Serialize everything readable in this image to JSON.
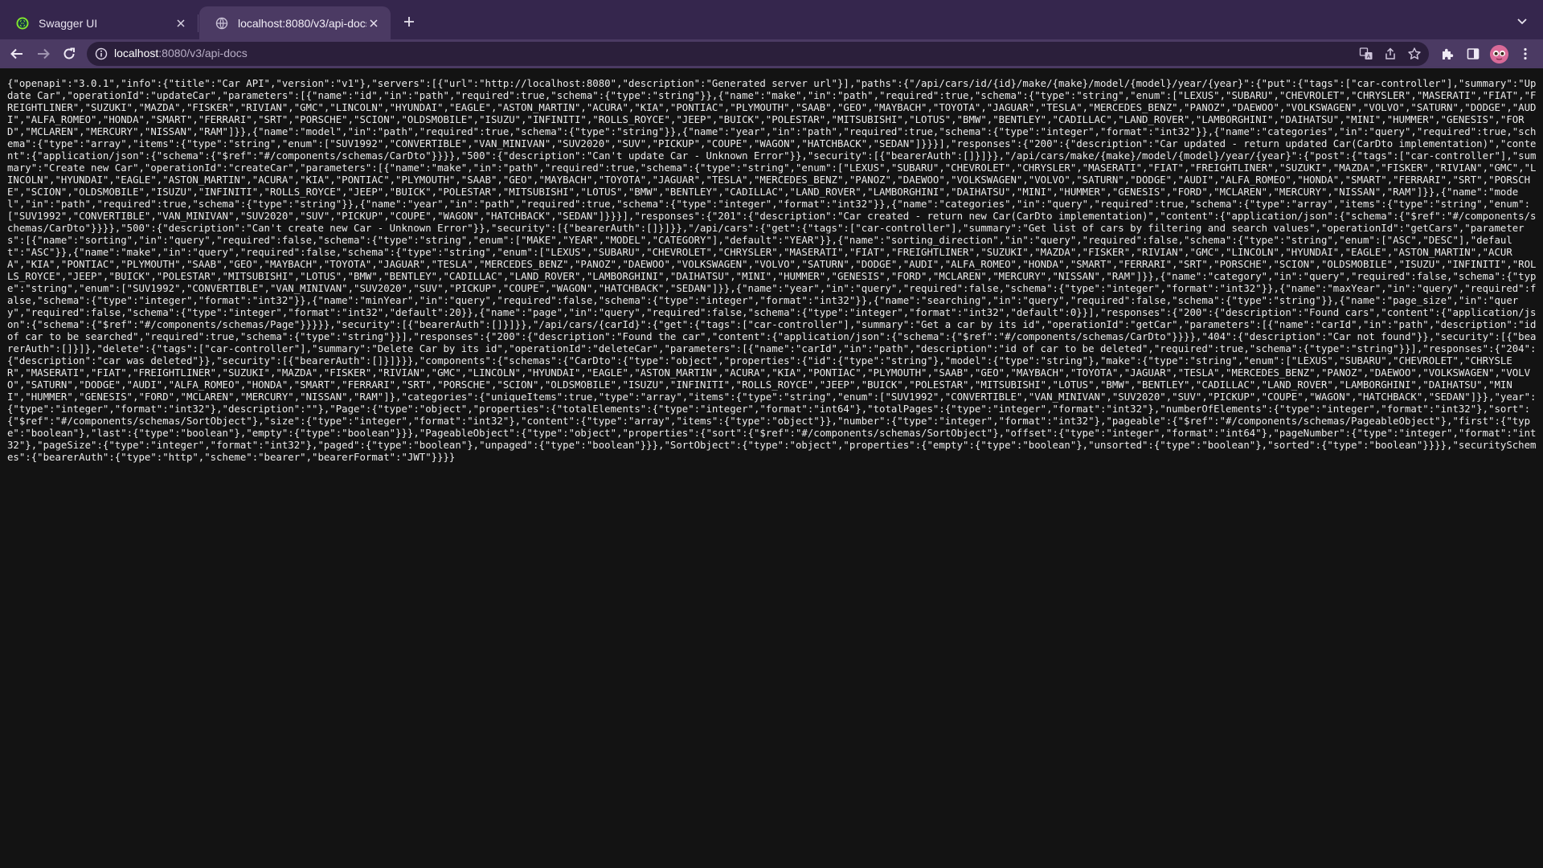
{
  "tabs": [
    {
      "title": "Swagger UI",
      "favicon": "swagger-globe-icon",
      "active": false
    },
    {
      "title": "localhost:8080/v3/api-docs",
      "favicon": "globe-icon",
      "active": true
    }
  ],
  "address_bar": {
    "host": "localhost",
    "path": ":8080/v3/api-docs"
  },
  "colors": {
    "tabstrip": "#35264d",
    "active_tab": "#4b3a63",
    "toolbar": "#4b3a63",
    "omnibox": "#2b1f3b",
    "page_background": "#131313",
    "text": "#ececec"
  },
  "content": {
    "json_text": "{\"openapi\":\"3.0.1\",\"info\":{\"title\":\"Car API\",\"version\":\"v1\"},\"servers\":[{\"url\":\"http://localhost:8080\",\"description\":\"Generated server url\"}],\"paths\":{\"/api/cars/id/{id}/make/{make}/model/{model}/year/{year}\":{\"put\":{\"tags\":[\"car-controller\"],\"summary\":\"Update Car\",\"operationId\":\"updateCar\",\"parameters\":[{\"name\":\"id\",\"in\":\"path\",\"required\":true,\"schema\":{\"type\":\"string\"}},{\"name\":\"make\",\"in\":\"path\",\"required\":true,\"schema\":{\"type\":\"string\",\"enum\":[\"LEXUS\",\"SUBARU\",\"CHEVROLET\",\"CHRYSLER\",\"MASERATI\",\"FIAT\",\"FREIGHTLINER\",\"SUZUKI\",\"MAZDA\",\"FISKER\",\"RIVIAN\",\"GMC\",\"LINCOLN\",\"HYUNDAI\",\"EAGLE\",\"ASTON_MARTIN\",\"ACURA\",\"KIA\",\"PONTIAC\",\"PLYMOUTH\",\"SAAB\",\"GEO\",\"MAYBACH\",\"TOYOTA\",\"JAGUAR\",\"TESLA\",\"MERCEDES_BENZ\",\"PANOZ\",\"DAEWOO\",\"VOLKSWAGEN\",\"VOLVO\",\"SATURN\",\"DODGE\",\"AUDI\",\"ALFA_ROMEO\",\"HONDA\",\"SMART\",\"FERRARI\",\"SRT\",\"PORSCHE\",\"SCION\",\"OLDSMOBILE\",\"ISUZU\",\"INFINITI\",\"ROLLS_ROYCE\",\"JEEP\",\"BUICK\",\"POLESTAR\",\"MITSUBISHI\",\"LOTUS\",\"BMW\",\"BENTLEY\",\"CADILLAC\",\"LAND_ROVER\",\"LAMBORGHINI\",\"DAIHATSU\",\"MINI\",\"HUMMER\",\"GENESIS\",\"FORD\",\"MCLAREN\",\"MERCURY\",\"NISSAN\",\"RAM\"]}},{\"name\":\"model\",\"in\":\"path\",\"required\":true,\"schema\":{\"type\":\"string\"}},{\"name\":\"year\",\"in\":\"path\",\"required\":true,\"schema\":{\"type\":\"integer\",\"format\":\"int32\"}},{\"name\":\"categories\",\"in\":\"query\",\"required\":true,\"schema\":{\"type\":\"array\",\"items\":{\"type\":\"string\",\"enum\":[\"SUV1992\",\"CONVERTIBLE\",\"VAN_MINIVAN\",\"SUV2020\",\"SUV\",\"PICKUP\",\"COUPE\",\"WAGON\",\"HATCHBACK\",\"SEDAN\"]}}}],\"responses\":{\"200\":{\"description\":\"Car updated - return updated Car(CarDto implementation)\",\"content\":{\"application/json\":{\"schema\":{\"$ref\":\"#/components/schemas/CarDto\"}}}},\"500\":{\"description\":\"Can't update Car - Unknown Error\"}},\"security\":[{\"bearerAuth\":[]}]}},\"/api/cars/make/{make}/model/{model}/year/{year}\":{\"post\":{\"tags\":[\"car-controller\"],\"summary\":\"Create new Car\",\"operationId\":\"createCar\",\"parameters\":[{\"name\":\"make\",\"in\":\"path\",\"required\":true,\"schema\":{\"type\":\"string\",\"enum\":[\"LEXUS\",\"SUBARU\",\"CHEVROLET\",\"CHRYSLER\",\"MASERATI\",\"FIAT\",\"FREIGHTLINER\",\"SUZUKI\",\"MAZDA\",\"FISKER\",\"RIVIAN\",\"GMC\",\"LINCOLN\",\"HYUNDAI\",\"EAGLE\",\"ASTON_MARTIN\",\"ACURA\",\"KIA\",\"PONTIAC\",\"PLYMOUTH\",\"SAAB\",\"GEO\",\"MAYBACH\",\"TOYOTA\",\"JAGUAR\",\"TESLA\",\"MERCEDES_BENZ\",\"PANOZ\",\"DAEWOO\",\"VOLKSWAGEN\",\"VOLVO\",\"SATURN\",\"DODGE\",\"AUDI\",\"ALFA_ROMEO\",\"HONDA\",\"SMART\",\"FERRARI\",\"SRT\",\"PORSCHE\",\"SCION\",\"OLDSMOBILE\",\"ISUZU\",\"INFINITI\",\"ROLLS_ROYCE\",\"JEEP\",\"BUICK\",\"POLESTAR\",\"MITSUBISHI\",\"LOTUS\",\"BMW\",\"BENTLEY\",\"CADILLAC\",\"LAND_ROVER\",\"LAMBORGHINI\",\"DAIHATSU\",\"MINI\",\"HUMMER\",\"GENESIS\",\"FORD\",\"MCLAREN\",\"MERCURY\",\"NISSAN\",\"RAM\"]}},{\"name\":\"model\",\"in\":\"path\",\"required\":true,\"schema\":{\"type\":\"string\"}},{\"name\":\"year\",\"in\":\"path\",\"required\":true,\"schema\":{\"type\":\"integer\",\"format\":\"int32\"}},{\"name\":\"categories\",\"in\":\"query\",\"required\":true,\"schema\":{\"type\":\"array\",\"items\":{\"type\":\"string\",\"enum\":[\"SUV1992\",\"CONVERTIBLE\",\"VAN_MINIVAN\",\"SUV2020\",\"SUV\",\"PICKUP\",\"COUPE\",\"WAGON\",\"HATCHBACK\",\"SEDAN\"]}}}],\"responses\":{\"201\":{\"description\":\"Car created - return new Car(CarDto implementation)\",\"content\":{\"application/json\":{\"schema\":{\"$ref\":\"#/components/schemas/CarDto\"}}}},\"500\":{\"description\":\"Can't create new Car - Unknown Error\"}},\"security\":[{\"bearerAuth\":[]}]}},\"/api/cars\":{\"get\":{\"tags\":[\"car-controller\"],\"summary\":\"Get list of cars by filtering and search values\",\"operationId\":\"getCars\",\"parameters\":[{\"name\":\"sorting\",\"in\":\"query\",\"required\":false,\"schema\":{\"type\":\"string\",\"enum\":[\"MAKE\",\"YEAR\",\"MODEL\",\"CATEGORY\"],\"default\":\"YEAR\"}},{\"name\":\"sorting_direction\",\"in\":\"query\",\"required\":false,\"schema\":{\"type\":\"string\",\"enum\":[\"ASC\",\"DESC\"],\"default\":\"ASC\"}},{\"name\":\"make\",\"in\":\"query\",\"required\":false,\"schema\":{\"type\":\"string\",\"enum\":[\"LEXUS\",\"SUBARU\",\"CHEVROLET\",\"CHRYSLER\",\"MASERATI\",\"FIAT\",\"FREIGHTLINER\",\"SUZUKI\",\"MAZDA\",\"FISKER\",\"RIVIAN\",\"GMC\",\"LINCOLN\",\"HYUNDAI\",\"EAGLE\",\"ASTON_MARTIN\",\"ACURA\",\"KIA\",\"PONTIAC\",\"PLYMOUTH\",\"SAAB\",\"GEO\",\"MAYBACH\",\"TOYOTA\",\"JAGUAR\",\"TESLA\",\"MERCEDES_BENZ\",\"PANOZ\",\"DAEWOO\",\"VOLKSWAGEN\",\"VOLVO\",\"SATURN\",\"DODGE\",\"AUDI\",\"ALFA_ROMEO\",\"HONDA\",\"SMART\",\"FERRARI\",\"SRT\",\"PORSCHE\",\"SCION\",\"OLDSMOBILE\",\"ISUZU\",\"INFINITI\",\"ROLLS_ROYCE\",\"JEEP\",\"BUICK\",\"POLESTAR\",\"MITSUBISHI\",\"LOTUS\",\"BMW\",\"BENTLEY\",\"CADILLAC\",\"LAND_ROVER\",\"LAMBORGHINI\",\"DAIHATSU\",\"MINI\",\"HUMMER\",\"GENESIS\",\"FORD\",\"MCLAREN\",\"MERCURY\",\"NISSAN\",\"RAM\"]}},{\"name\":\"category\",\"in\":\"query\",\"required\":false,\"schema\":{\"type\":\"string\",\"enum\":[\"SUV1992\",\"CONVERTIBLE\",\"VAN_MINIVAN\",\"SUV2020\",\"SUV\",\"PICKUP\",\"COUPE\",\"WAGON\",\"HATCHBACK\",\"SEDAN\"]}},{\"name\":\"year\",\"in\":\"query\",\"required\":false,\"schema\":{\"type\":\"integer\",\"format\":\"int32\"}},{\"name\":\"maxYear\",\"in\":\"query\",\"required\":false,\"schema\":{\"type\":\"integer\",\"format\":\"int32\"}},{\"name\":\"minYear\",\"in\":\"query\",\"required\":false,\"schema\":{\"type\":\"integer\",\"format\":\"int32\"}},{\"name\":\"searching\",\"in\":\"query\",\"required\":false,\"schema\":{\"type\":\"string\"}},{\"name\":\"page_size\",\"in\":\"query\",\"required\":false,\"schema\":{\"type\":\"integer\",\"format\":\"int32\",\"default\":20}},{\"name\":\"page\",\"in\":\"query\",\"required\":false,\"schema\":{\"type\":\"integer\",\"format\":\"int32\",\"default\":0}}],\"responses\":{\"200\":{\"description\":\"Found cars\",\"content\":{\"application/json\":{\"schema\":{\"$ref\":\"#/components/schemas/Page\"}}}}},\"security\":[{\"bearerAuth\":[]}]}},\"/api/cars/{carId}\":{\"get\":{\"tags\":[\"car-controller\"],\"summary\":\"Get a car by its id\",\"operationId\":\"getCar\",\"parameters\":[{\"name\":\"carId\",\"in\":\"path\",\"description\":\"id of car to be searched\",\"required\":true,\"schema\":{\"type\":\"string\"}}],\"responses\":{\"200\":{\"description\":\"Found the car\",\"content\":{\"application/json\":{\"schema\":{\"$ref\":\"#/components/schemas/CarDto\"}}}},\"404\":{\"description\":\"Car not found\"}},\"security\":[{\"bearerAuth\":[]}]},\"delete\":{\"tags\":[\"car-controller\"],\"summary\":\"Delete Car by its id\",\"operationId\":\"deleteCar\",\"parameters\":[{\"name\":\"carId\",\"in\":\"path\",\"description\":\"id of car to be deleted\",\"required\":true,\"schema\":{\"type\":\"string\"}}],\"responses\":{\"204\":{\"description\":\"car was deleted\"}},\"security\":[{\"bearerAuth\":[]}]}}},\"components\":{\"schemas\":{\"CarDto\":{\"type\":\"object\",\"properties\":{\"id\":{\"type\":\"string\"},\"model\":{\"type\":\"string\"},\"make\":{\"type\":\"string\",\"enum\":[\"LEXUS\",\"SUBARU\",\"CHEVROLET\",\"CHRYSLER\",\"MASERATI\",\"FIAT\",\"FREIGHTLINER\",\"SUZUKI\",\"MAZDA\",\"FISKER\",\"RIVIAN\",\"GMC\",\"LINCOLN\",\"HYUNDAI\",\"EAGLE\",\"ASTON_MARTIN\",\"ACURA\",\"KIA\",\"PONTIAC\",\"PLYMOUTH\",\"SAAB\",\"GEO\",\"MAYBACH\",\"TOYOTA\",\"JAGUAR\",\"TESLA\",\"MERCEDES_BENZ\",\"PANOZ\",\"DAEWOO\",\"VOLKSWAGEN\",\"VOLVO\",\"SATURN\",\"DODGE\",\"AUDI\",\"ALFA_ROMEO\",\"HONDA\",\"SMART\",\"FERRARI\",\"SRT\",\"PORSCHE\",\"SCION\",\"OLDSMOBILE\",\"ISUZU\",\"INFINITI\",\"ROLLS_ROYCE\",\"JEEP\",\"BUICK\",\"POLESTAR\",\"MITSUBISHI\",\"LOTUS\",\"BMW\",\"BENTLEY\",\"CADILLAC\",\"LAND_ROVER\",\"LAMBORGHINI\",\"DAIHATSU\",\"MINI\",\"HUMMER\",\"GENESIS\",\"FORD\",\"MCLAREN\",\"MERCURY\",\"NISSAN\",\"RAM\"]},\"categories\":{\"uniqueItems\":true,\"type\":\"array\",\"items\":{\"type\":\"string\",\"enum\":[\"SUV1992\",\"CONVERTIBLE\",\"VAN_MINIVAN\",\"SUV2020\",\"SUV\",\"PICKUP\",\"COUPE\",\"WAGON\",\"HATCHBACK\",\"SEDAN\"]}},\"year\":{\"type\":\"integer\",\"format\":\"int32\"},\"description\":\"\"},\"Page\":{\"type\":\"object\",\"properties\":{\"totalElements\":{\"type\":\"integer\",\"format\":\"int64\"},\"totalPages\":{\"type\":\"integer\",\"format\":\"int32\"},\"numberOfElements\":{\"type\":\"integer\",\"format\":\"int32\"},\"sort\":{\"$ref\":\"#/components/schemas/SortObject\"},\"size\":{\"type\":\"integer\",\"format\":\"int32\"},\"content\":{\"type\":\"array\",\"items\":{\"type\":\"object\"}},\"number\":{\"type\":\"integer\",\"format\":\"int32\"},\"pageable\":{\"$ref\":\"#/components/schemas/PageableObject\"},\"first\":{\"type\":\"boolean\"},\"last\":{\"type\":\"boolean\"},\"empty\":{\"type\":\"boolean\"}}},\"PageableObject\":{\"type\":\"object\",\"properties\":{\"sort\":{\"$ref\":\"#/components/schemas/SortObject\"},\"offset\":{\"type\":\"integer\",\"format\":\"int64\"},\"pageNumber\":{\"type\":\"integer\",\"format\":\"int32\"},\"pageSize\":{\"type\":\"integer\",\"format\":\"int32\"},\"paged\":{\"type\":\"boolean\"},\"unpaged\":{\"type\":\"boolean\"}}},\"SortObject\":{\"type\":\"object\",\"properties\":{\"empty\":{\"type\":\"boolean\"},\"unsorted\":{\"type\":\"boolean\"},\"sorted\":{\"type\":\"boolean\"}}}},\"securitySchemes\":{\"bearerAuth\":{\"type\":\"http\",\"scheme\":\"bearer\",\"bearerFormat\":\"JWT\"}}}}"
  }
}
